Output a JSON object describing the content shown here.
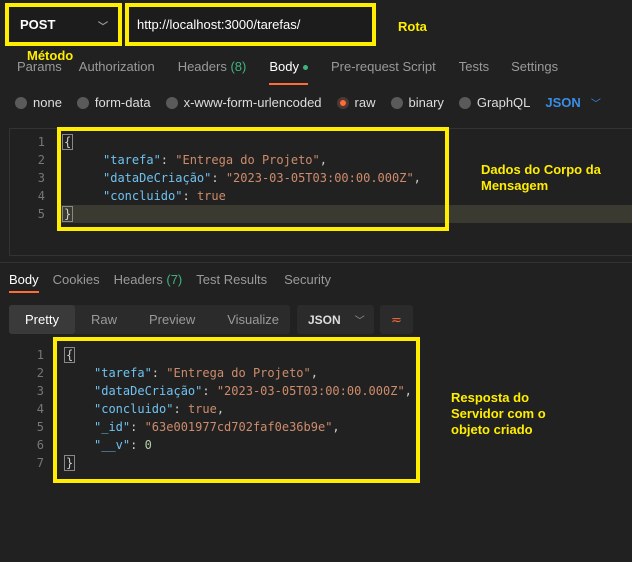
{
  "request": {
    "method": "POST",
    "url": "http://localhost:3000/tarefas/"
  },
  "annotations": {
    "method": "Método",
    "route": "Rota",
    "body": "Dados do Corpo da Mensagem",
    "response": "Resposta do Servidor com o objeto criado"
  },
  "request_tabs": [
    {
      "label": "Params"
    },
    {
      "label": "Authorization"
    },
    {
      "label": "Headers",
      "count": "(8)"
    },
    {
      "label": "Body",
      "active": true
    },
    {
      "label": "Pre-request Script"
    },
    {
      "label": "Tests"
    },
    {
      "label": "Settings"
    }
  ],
  "body_types": [
    "none",
    "form-data",
    "x-www-form-urlencoded",
    "raw",
    "binary",
    "GraphQL"
  ],
  "body_type_selected": "raw",
  "body_format": "JSON",
  "request_body": {
    "l1": "{",
    "l2k": "\"tarefa\"",
    "l2v": "\"Entrega do Projeto\"",
    "l3k": "\"dataDeCriação\"",
    "l3v": "\"2023-03-05T03:00:00.000Z\"",
    "l4k": "\"concluido\"",
    "l4v": "true",
    "l5": "}"
  },
  "response_tabs": [
    {
      "label": "Body",
      "active": true
    },
    {
      "label": "Cookies"
    },
    {
      "label": "Headers",
      "count": "(7)"
    },
    {
      "label": "Test Results"
    },
    {
      "label": "Security"
    }
  ],
  "view_modes": [
    "Pretty",
    "Raw",
    "Preview",
    "Visualize"
  ],
  "response_format": "JSON",
  "response_body": {
    "l1": "{",
    "l2k": "\"tarefa\"",
    "l2v": "\"Entrega do Projeto\"",
    "l3k": "\"dataDeCriação\"",
    "l3v": "\"2023-03-05T03:00:00.000Z\"",
    "l4k": "\"concluido\"",
    "l4v": "true",
    "l5k": "\"_id\"",
    "l5v": "\"63e001977cd702faf0e36b9e\"",
    "l6k": "\"__v\"",
    "l6v": "0",
    "l7": "}"
  },
  "line_numbers": [
    "1",
    "2",
    "3",
    "4",
    "5",
    "6",
    "7"
  ],
  "colors": {
    "accent": "#ff6c37",
    "highlight": "#ffee00",
    "json_key": "#6fc2f0",
    "json_string": "#ce8c6c"
  }
}
